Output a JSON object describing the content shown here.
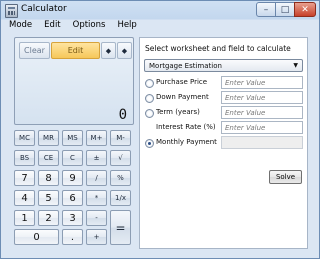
{
  "window": {
    "title": "Calculator"
  },
  "menu": [
    "Mode",
    "Edit",
    "Options",
    "Help"
  ],
  "display": {
    "buttons": {
      "clear": "Clear",
      "edit": "Edit",
      "prev": "◆",
      "next": "◆"
    },
    "value": "0"
  },
  "keys": {
    "r1": [
      "MC",
      "MR",
      "MS",
      "M+",
      "M-"
    ],
    "r2": [
      "BS",
      "CE",
      "C",
      "±",
      "√"
    ],
    "r3": [
      "7",
      "8",
      "9",
      "/",
      "%"
    ],
    "r4": [
      "4",
      "5",
      "6",
      "*",
      "1/x"
    ],
    "r5": [
      "1",
      "2",
      "3",
      "-"
    ],
    "r6": [
      "0",
      ".",
      "+"
    ],
    "equals": "="
  },
  "worksheet": {
    "prompt": "Select worksheet and field to calculate",
    "selected": "Mortgage Estimation",
    "fields": [
      {
        "label": "Purchase Price",
        "placeholder": "Enter Value",
        "selected": false,
        "has_radio": true
      },
      {
        "label": "Down Payment",
        "placeholder": "Enter Value",
        "selected": false,
        "has_radio": true
      },
      {
        "label": "Term (years)",
        "placeholder": "Enter Value",
        "selected": false,
        "has_radio": true
      },
      {
        "label": "Interest Rate (%)",
        "placeholder": "Enter Value",
        "selected": false,
        "has_radio": false
      },
      {
        "label": "Monthly Payment",
        "placeholder": "",
        "selected": true,
        "has_radio": true
      }
    ],
    "solve": "Solve"
  }
}
